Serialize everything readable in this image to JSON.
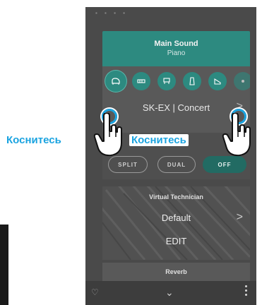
{
  "top_status": "▪ ▪ ▪ ▪",
  "main_sound": {
    "title": "Main Sound",
    "subtitle": "Piano",
    "categories": [
      "piano-icon",
      "electric-piano-icon",
      "organ-icon",
      "harpsichord-icon",
      "strings-icon",
      "more-icon"
    ],
    "selected_sound": "SK-EX | Concert",
    "chevron": ">"
  },
  "modes": {
    "split": "SPLIT",
    "dual": "DUAL",
    "off": "OFF"
  },
  "virtual_technician": {
    "title": "Virtual Technician",
    "value": "Default",
    "chevron": ">",
    "edit": "EDIT"
  },
  "reverb": {
    "title": "Reverb"
  },
  "bottom_bar": {
    "heart": "♡",
    "down": "⌄"
  },
  "callouts": {
    "left": "Коснитесь",
    "right": "Коснитесь"
  },
  "colors": {
    "accent": "#2d8a80",
    "callout": "#1aa3e0"
  }
}
